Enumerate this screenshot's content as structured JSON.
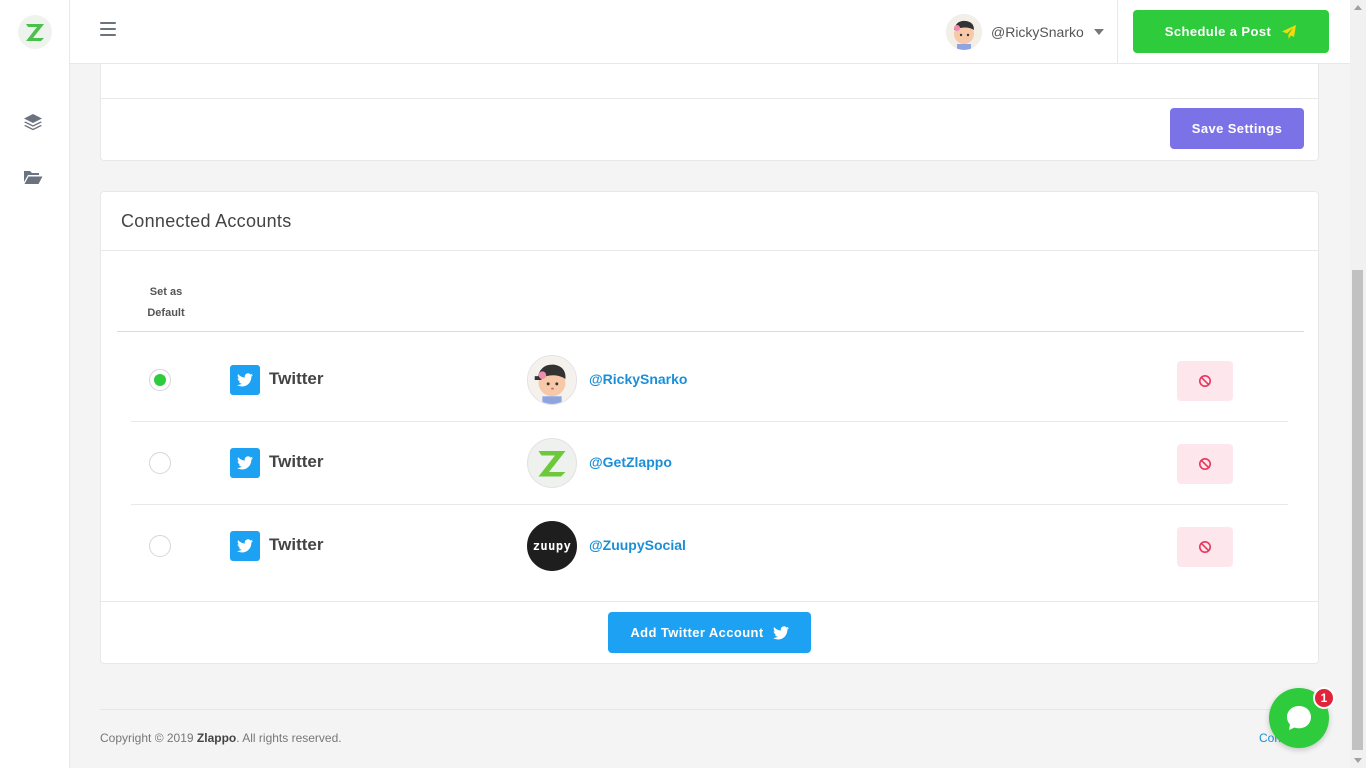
{
  "header": {
    "username": "@RickySnarko",
    "schedule_button": "Schedule a Post"
  },
  "sidebar": {
    "icons": [
      "layers-icon",
      "folder-open-icon"
    ]
  },
  "settings": {
    "save_button": "Save Settings"
  },
  "accounts": {
    "title": "Connected Accounts",
    "column_default": "Set as Default",
    "rows": [
      {
        "network": "Twitter",
        "handle": "@RickySnarko",
        "default": true
      },
      {
        "network": "Twitter",
        "handle": "@GetZlappo",
        "default": false
      },
      {
        "network": "Twitter",
        "handle": "@ZuupySocial",
        "default": false
      }
    ],
    "zuupy_logo_text": "zuupy",
    "add_button": "Add Twitter Account"
  },
  "footer": {
    "copyright_prefix": "Copyright © 2019",
    "brand": "Zlappo",
    "copyright_suffix": ". All rights reserved.",
    "link_partial": "Con"
  },
  "chat": {
    "badge_count": "1"
  },
  "colors": {
    "brand_green": "#2ecb3d",
    "purple": "#7b72e8",
    "twitter_blue": "#1da1f2",
    "link_blue": "#1a8fd8"
  }
}
